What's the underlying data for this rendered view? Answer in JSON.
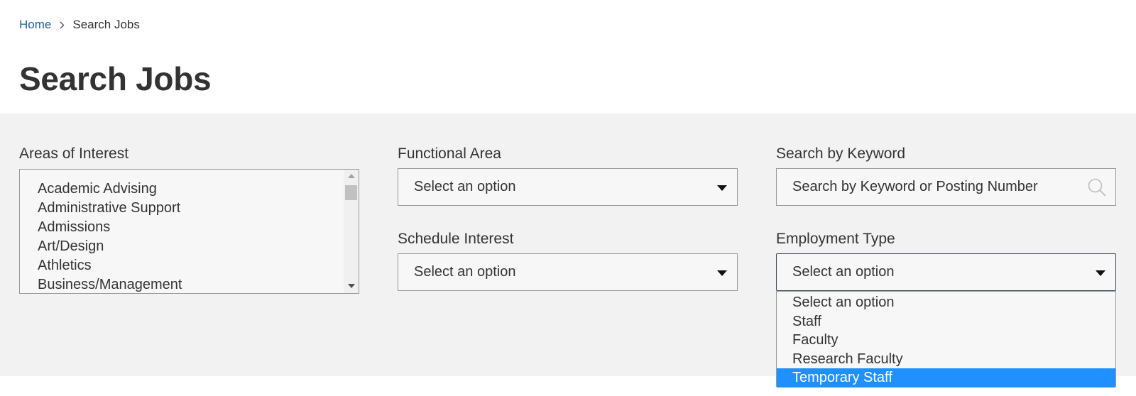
{
  "breadcrumb": {
    "home": "Home",
    "current": "Search Jobs"
  },
  "page_title": "Search Jobs",
  "filters": {
    "areas": {
      "label": "Areas of Interest",
      "options": [
        "Academic Advising",
        "Administrative Support",
        "Admissions",
        "Art/Design",
        "Athletics",
        "Business/Management"
      ]
    },
    "functional": {
      "label": "Functional Area",
      "value": "Select an option"
    },
    "schedule": {
      "label": "Schedule Interest",
      "value": "Select an option"
    },
    "keyword": {
      "label": "Search by Keyword",
      "placeholder": "Search by Keyword or Posting Number"
    },
    "employment": {
      "label": "Employment Type",
      "value": "Select an option",
      "options": [
        "Select an option",
        "Staff",
        "Faculty",
        "Research Faculty",
        "Temporary Staff"
      ],
      "highlighted": "Temporary Staff"
    }
  },
  "colors": {
    "link": "#1f5fa6",
    "panel": "#f2f2f2",
    "highlight": "#1e90ff"
  },
  "icons": {
    "breadcrumb_separator": "chevron-right-icon",
    "search": "search-icon",
    "select": "caret-down-icon"
  }
}
